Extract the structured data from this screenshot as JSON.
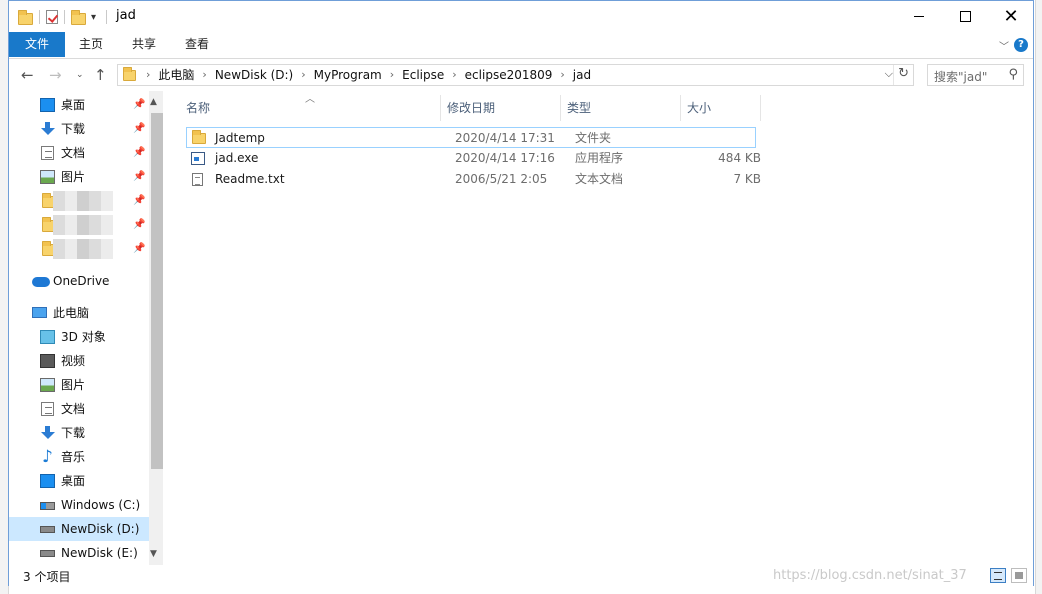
{
  "window": {
    "title": "jad"
  },
  "ribbon": {
    "tabs": [
      {
        "label": "文件",
        "active": true
      },
      {
        "label": "主页"
      },
      {
        "label": "共享"
      },
      {
        "label": "查看"
      }
    ]
  },
  "address": {
    "breadcrumbs": [
      "此电脑",
      "NewDisk (D:)",
      "MyProgram",
      "Eclipse",
      "eclipse201809",
      "jad"
    ]
  },
  "search": {
    "placeholder": "搜索\"jad\""
  },
  "navpane": {
    "quick_access": [
      {
        "label": "桌面",
        "icon": "desktop-icon",
        "pinned": true
      },
      {
        "label": "下载",
        "icon": "download-icon",
        "pinned": true
      },
      {
        "label": "文档",
        "icon": "document-icon",
        "pinned": true
      },
      {
        "label": "图片",
        "icon": "picture-icon",
        "pinned": true
      }
    ],
    "onedrive": "OneDrive",
    "this_pc": "此电脑",
    "pc_items": [
      {
        "label": "3D 对象",
        "icon": "3d-objects-icon"
      },
      {
        "label": "视频",
        "icon": "video-icon"
      },
      {
        "label": "图片",
        "icon": "picture-icon"
      },
      {
        "label": "文档",
        "icon": "document-icon"
      },
      {
        "label": "下载",
        "icon": "download-icon"
      },
      {
        "label": "音乐",
        "icon": "music-icon"
      },
      {
        "label": "桌面",
        "icon": "desktop-icon"
      },
      {
        "label": "Windows (C:)",
        "icon": "windows-drive-icon"
      },
      {
        "label": "NewDisk (D:)",
        "icon": "drive-icon",
        "selected": true
      },
      {
        "label": "NewDisk (E:)",
        "icon": "drive-icon"
      }
    ]
  },
  "columns": {
    "name": "名称",
    "modified": "修改日期",
    "type": "类型",
    "size": "大小"
  },
  "files": [
    {
      "name": "Jadtemp",
      "modified": "2020/4/14 17:31",
      "type": "文件夹",
      "size": "",
      "icon": "folder-icon"
    },
    {
      "name": "jad.exe",
      "modified": "2020/4/14 17:16",
      "type": "应用程序",
      "size": "484 KB",
      "icon": "exe-icon"
    },
    {
      "name": "Readme.txt",
      "modified": "2006/5/21 2:05",
      "type": "文本文档",
      "size": "7 KB",
      "icon": "text-file-icon"
    }
  ],
  "status": {
    "item_count": "3 个项目"
  },
  "watermark": "https://blog.csdn.net/sinat_37"
}
